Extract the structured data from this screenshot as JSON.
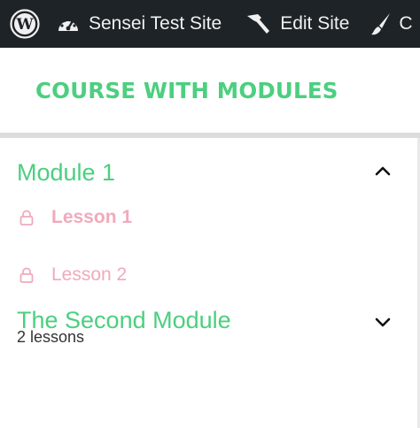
{
  "admin_bar": {
    "site_name": "Sensei Test Site",
    "edit_site_label": "Edit Site",
    "customize_label": "C",
    "icons": {
      "logo": "wordpress-logo-icon",
      "site": "dashboard-gauge-icon",
      "edit": "hammer-icon",
      "customize": "paintbrush-icon"
    },
    "colors": {
      "background": "#1d2327",
      "text": "#f0f0f1"
    }
  },
  "course": {
    "title": "COURSE WITH MODULES",
    "accent_color": "#4ccf7f"
  },
  "modules": [
    {
      "title": "Module 1",
      "expanded": true,
      "toggle_icon": "chevron-up-icon",
      "lessons": [
        {
          "label": "Lesson 1",
          "current": true,
          "locked": true,
          "icon": "lock-icon"
        },
        {
          "label": "Lesson 2",
          "current": false,
          "locked": true,
          "icon": "lock-icon"
        }
      ]
    },
    {
      "title": "The Second Module",
      "expanded": false,
      "toggle_icon": "chevron-down-icon",
      "lesson_count": "2 lessons"
    }
  ],
  "colors": {
    "lesson_text": "#f0aabb",
    "divider": "#dcdcdc"
  }
}
